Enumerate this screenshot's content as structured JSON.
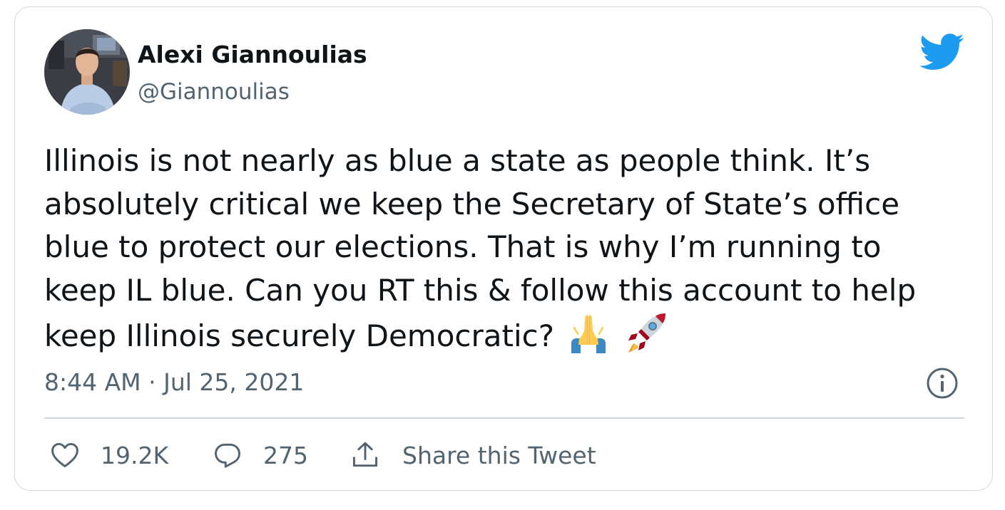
{
  "author": {
    "name": "Alexi Giannoulias",
    "handle": "@Giannoulias"
  },
  "tweet": {
    "lines": [
      "Illinois is not nearly as blue a state as people think. It’s",
      "absolutely critical we keep the Secretary of State’s office",
      "blue to protect our elections. That is why I’m running to",
      "keep IL blue. Can you RT this & follow this account to help",
      "keep Illinois securely Democratic?"
    ],
    "emojis": [
      "folded-hands-emoji",
      "rocket-emoji"
    ],
    "timestamp": "8:44 AM · Jul 25, 2021"
  },
  "actions": {
    "likes": "19.2K",
    "replies": "275",
    "share_label": "Share this Tweet"
  },
  "colors": {
    "text": "#0f1419",
    "secondary": "#536471",
    "brand": "#1d9bf0",
    "border": "#cfd9de"
  },
  "icons": [
    "twitter-bird-icon",
    "info-icon",
    "heart-icon",
    "reply-bubble-icon",
    "share-icon"
  ]
}
